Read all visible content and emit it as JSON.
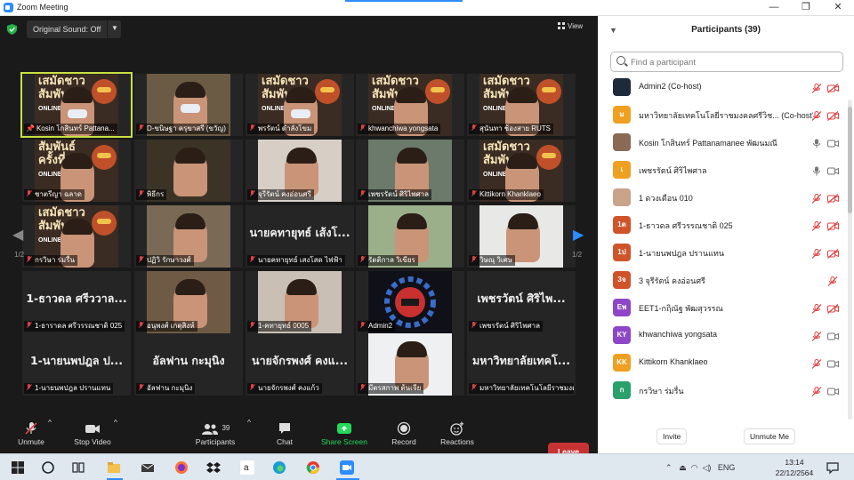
{
  "window": {
    "title": "Zoom Meeting",
    "minimize": "—",
    "restore": "❐",
    "close": "✕"
  },
  "meeting": {
    "original_sound_label": "Original Sound: Off",
    "view_label": "View",
    "page_indicator_left": "1/2",
    "page_indicator_right": "1/2",
    "poster": {
      "line1": "เสมัดชาว",
      "line2": "สัมพันธ์",
      "line3": "ครั้งที่ 3",
      "online": "ONLINE"
    },
    "tiles": [
      {
        "name": "Kosin โกสินทร์ Pattana...",
        "pinned": true
      },
      {
        "name": "D-ขนิษฐา ครุขาสรี (ขวัญ)"
      },
      {
        "name": "พรรัตน์ ดำลังโขม"
      },
      {
        "name": "khwanchiwa yongsata"
      },
      {
        "name": "สุนันทา ช้องสาย RUTS"
      },
      {
        "name": "ชาตรีญา ฉลาด"
      },
      {
        "name": "พิธีกร"
      },
      {
        "name": "จุรีรัตน์ คงอ่อนศรี"
      },
      {
        "name": "เพชรรัตน์ ศิริไพศาล"
      },
      {
        "name": "Kittikorn Khanklaeo"
      },
      {
        "name": "กรวิษา ร่มรื่น"
      },
      {
        "name": "ปฏิวิ รักษาวงศ์"
      },
      {
        "name": "นายคทายุทธ์ เสงโสด ไฟฟ้า",
        "big": "นายคทายุทธ์ เส้งโ..."
      },
      {
        "name": "รัตติกาล วิเขียร"
      },
      {
        "name": "วิษณุ วิเศษ"
      },
      {
        "name": "1-ธาราดล ศรีวรรณชาติ 025",
        "big": "1-ธาวดล ศรีววาล..."
      },
      {
        "name": "อนุพงศ์ เกตุสิงห์"
      },
      {
        "name": "1-คทายุทธ์ 0005"
      },
      {
        "name": "Admin2"
      },
      {
        "name": "เพชรรัตน์ ศิริไพศาล",
        "big": "เพชรวัตน์ ศิริไพ..."
      },
      {
        "name": "1-นายนพปฎล ปรานแทน",
        "big": "1-นายนพปฎล ป..."
      },
      {
        "name": "อัลฟาน กะมุนิง",
        "big": "อัลฟาน กะมุนิง"
      },
      {
        "name": "นายจักรพงศ์ คงแก้ว",
        "big": "นายจักรพงศ์ คงแ..."
      },
      {
        "name": "มีตรสกาพ ต้นเจีย"
      },
      {
        "name": "มหาวิทยาลัยเทคโนโลยีราชมงคล",
        "big": "มหาวิทยาลัยเทคโ..."
      }
    ]
  },
  "toolbar": {
    "unmute": "Unmute",
    "stop_video": "Stop Video",
    "participants": "Participants",
    "participants_count": "39",
    "chat": "Chat",
    "share_screen": "Share Screen",
    "record": "Record",
    "reactions": "Reactions",
    "leave": "Leave"
  },
  "panel": {
    "title": "Participants (39)",
    "search_placeholder": "Find a participant",
    "invite": "Invite",
    "unmute_me": "Unmute Me",
    "participants": [
      {
        "name": "Admin2 (Co-host)",
        "initials": "",
        "color": "#1c2a3a",
        "mic": "muted",
        "cam": "off"
      },
      {
        "name": "มหาวิทยาลัยเทคโนโลยีราชมงคลศรีวิช... (Co-host)",
        "initials": "ม",
        "color": "#f0a020",
        "mic": "muted",
        "cam": "off"
      },
      {
        "name": "Kosin โกสินทร์ Pattanamanee พัฒนมณี",
        "initials": "",
        "color": "#8a6a55",
        "mic": "on",
        "cam": "on"
      },
      {
        "name": "เพชรรัตน์ ศิริไพศาล",
        "initials": "เ",
        "color": "#f0a020",
        "mic": "on",
        "cam": "on"
      },
      {
        "name": "1 ดวงเดือน 010",
        "initials": "",
        "color": "#c9a38a",
        "mic": "muted",
        "cam": "off"
      },
      {
        "name": "1-ธาวดล ศรีวรรณชาติ 025",
        "initials": "1ต",
        "color": "#d0542a",
        "mic": "muted",
        "cam": "off"
      },
      {
        "name": "1-นายนพปฎล ปรานแทน",
        "initials": "1ป",
        "color": "#d0542a",
        "mic": "muted",
        "cam": "off"
      },
      {
        "name": "3 จุรีรัตน์ คงอ่อนศรี",
        "initials": "3จ",
        "color": "#d0542a",
        "mic": "muted",
        "cam": "none"
      },
      {
        "name": "EET1-กฤิณัฐ พัฒสุวรรณ",
        "initials": "Eพ",
        "color": "#8d46c8",
        "mic": "muted",
        "cam": "off"
      },
      {
        "name": "khwanchiwa yongsata",
        "initials": "KY",
        "color": "#8d46c8",
        "mic": "muted",
        "cam": "on"
      },
      {
        "name": "Kittikorn Khanklaeo",
        "initials": "KK",
        "color": "#f0a020",
        "mic": "muted",
        "cam": "on"
      },
      {
        "name": "กรวิษา ร่มรื่น",
        "initials": "ก",
        "color": "#2aa06a",
        "mic": "muted",
        "cam": "on"
      }
    ]
  },
  "taskbar": {
    "search_icon": "search-icon",
    "lang": "ENG",
    "time": "13:14",
    "date": "22/12/2564"
  },
  "colors": {
    "accent": "#2d8cff",
    "active_speaker": "#c7e042",
    "leave": "#c73333",
    "share": "#23d959",
    "muted": "#e04343"
  }
}
